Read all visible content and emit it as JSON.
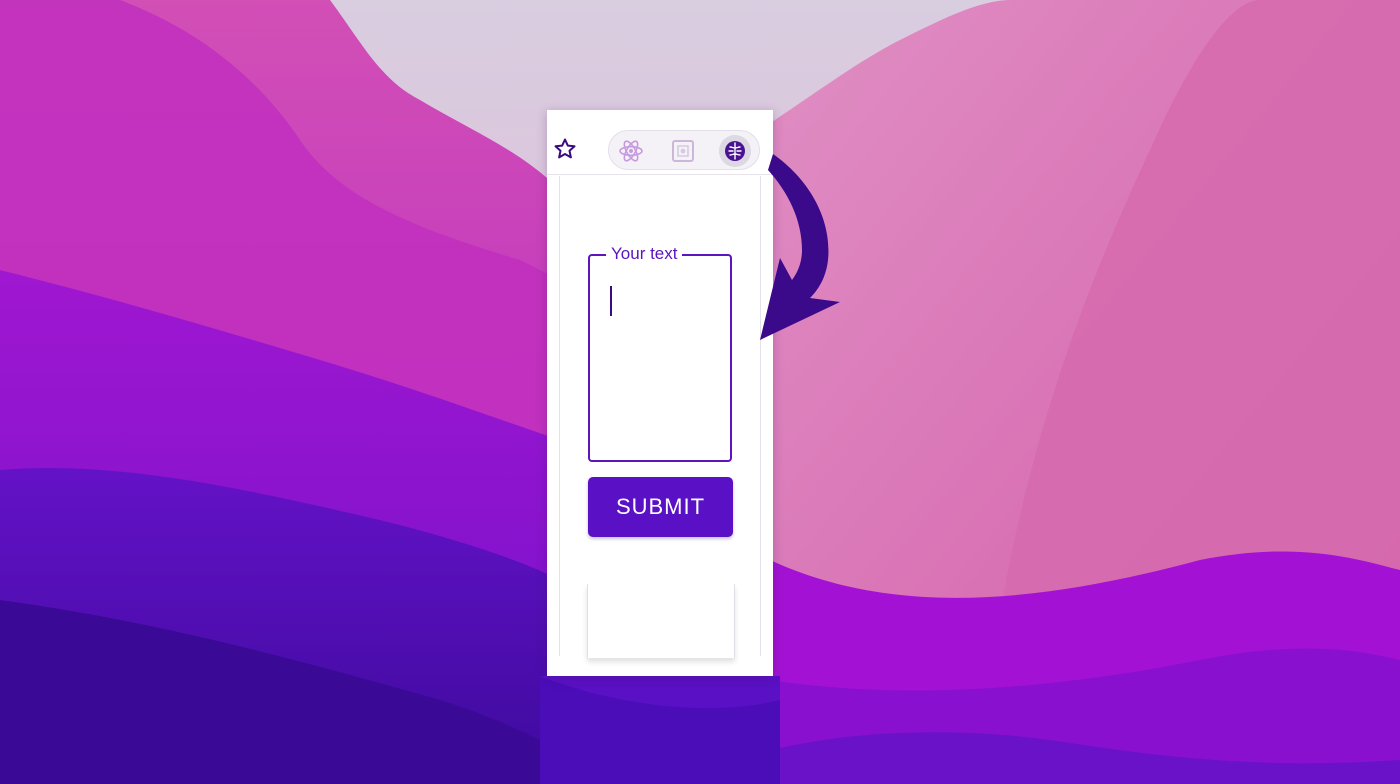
{
  "wallpaper": {
    "description_colors": [
      "#d8c8de",
      "#d64fb5",
      "#b826c2",
      "#8a14d0",
      "#5a10c4",
      "#3a0a9a"
    ]
  },
  "toolbar": {
    "bookmark_icon": "star-outline-icon",
    "extensions": [
      {
        "icon": "react-atom-icon"
      },
      {
        "icon": "puzzle-icon"
      },
      {
        "icon": "brain-icon",
        "active": true
      }
    ]
  },
  "popup": {
    "text_field": {
      "label": "Your text",
      "value": ""
    },
    "submit_label": "SUBMIT"
  },
  "colors": {
    "accent": "#5a10c4",
    "arrow": "#3a0a8a"
  }
}
